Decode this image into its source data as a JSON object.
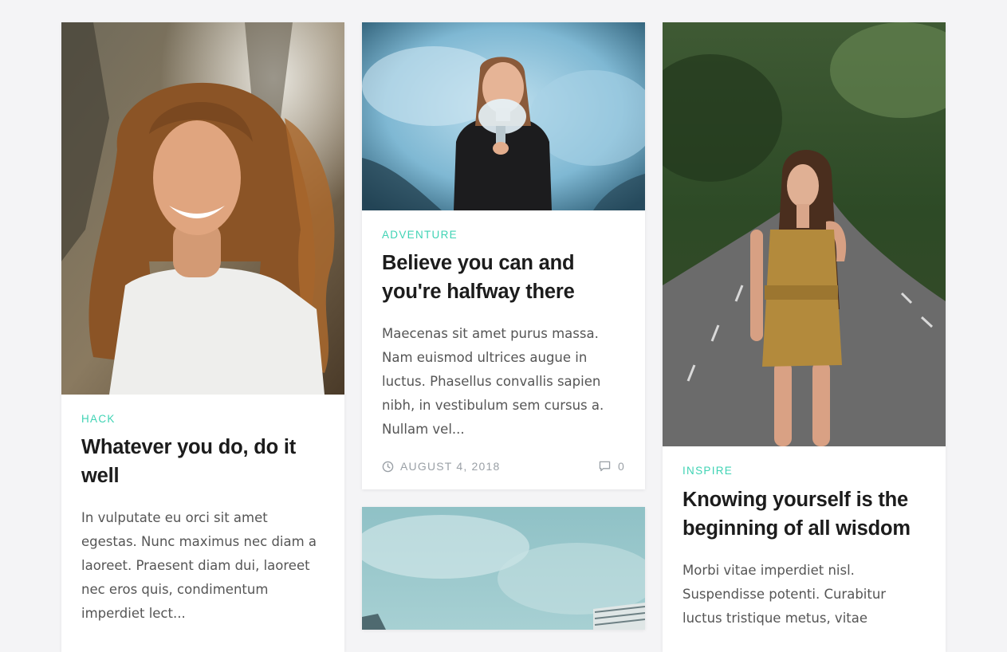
{
  "posts": [
    {
      "category": "Hack",
      "title": "Whatever you do, do it well",
      "excerpt": "In vulputate eu orci sit amet egestas. Nunc maximus nec diam a laoreet. Praesent diam dui, laoreet nec eros quis, condimentum imperdiet lect..."
    },
    {
      "category": "Adventure",
      "title": "Believe you can and you're halfway there",
      "excerpt": "Maecenas sit amet purus massa. Nam euismod ultrices augue in luctus. Phasellus convallis sapien nibh, in vestibulum sem cursus a. Nullam vel...",
      "date": "August 4, 2018",
      "comments": "0"
    },
    {
      "category": "Inspire",
      "title": "Knowing yourself is the beginning of all wisdom",
      "excerpt": "Morbi vitae imperdiet nisl. Suspendisse potenti. Curabitur luctus tristique metus, vitae"
    }
  ],
  "colors": {
    "accent": "#3fd3b4",
    "background": "#f4f4f6",
    "title": "#1c1c1c",
    "text": "#555555",
    "meta": "#9aa0a6"
  },
  "icons": {
    "date": "clock-icon",
    "comments": "comment-icon"
  }
}
